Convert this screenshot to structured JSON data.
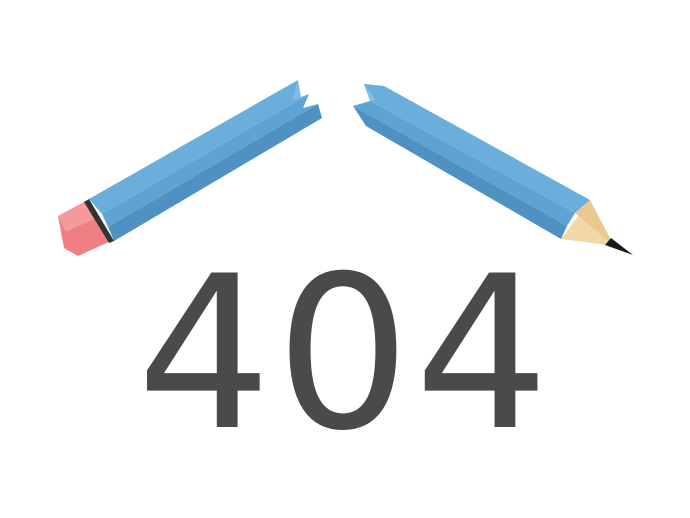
{
  "error_code": "404",
  "illustration": {
    "icon": "broken-pencil-icon"
  },
  "colors": {
    "background": "#ffffff",
    "text": "#4a4a4a",
    "pencil_light": "#6aaedb",
    "pencil_mid": "#5a9ccb",
    "pencil_dark": "#4f8fbf",
    "eraser": "#f08080",
    "ferrule": "#333333",
    "wood": "#f2d9a8",
    "lead": "#1a1a1a"
  }
}
